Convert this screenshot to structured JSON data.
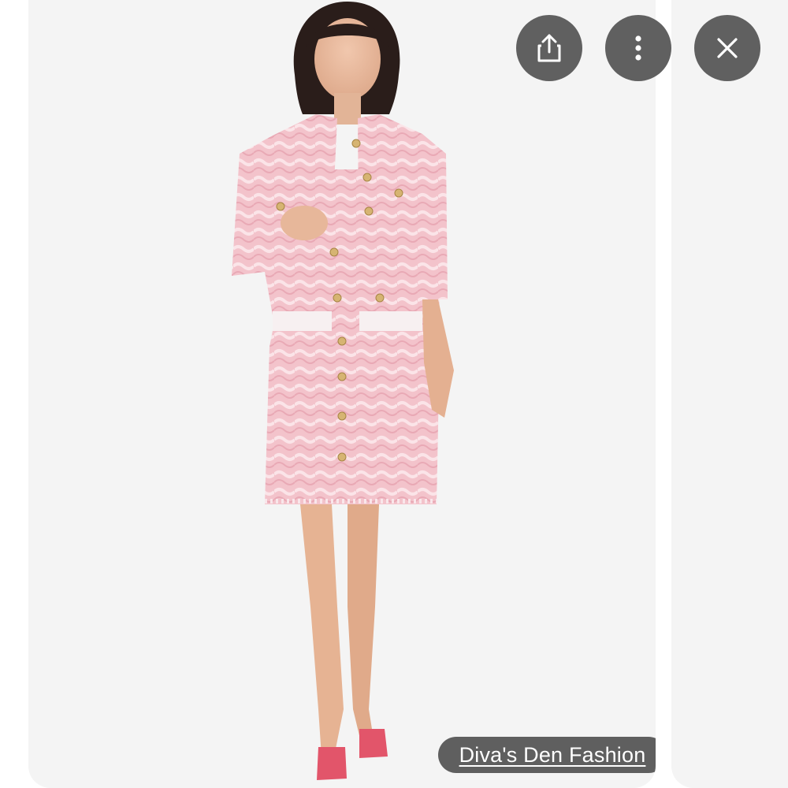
{
  "viewer": {
    "actions": [
      {
        "icon": "share-icon",
        "label": "Share"
      },
      {
        "icon": "more-vert-icon",
        "label": "More options"
      },
      {
        "icon": "close-icon",
        "label": "Close"
      }
    ],
    "source_label": "Diva's Den Fashion"
  },
  "colors": {
    "button_bg": "#606060",
    "chip_bg": "#5f5f5f",
    "card_bg": "#f4f4f4",
    "outfit_pink": "#f3c3cb"
  }
}
